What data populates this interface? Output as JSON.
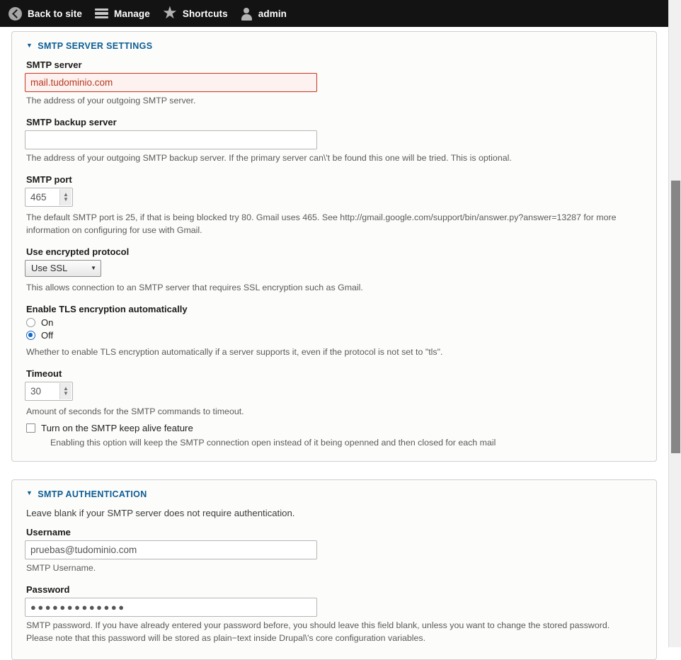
{
  "toolbar": {
    "items": [
      {
        "label": "Back to site",
        "icon": "back-circle-icon"
      },
      {
        "label": "Manage",
        "icon": "hamburger-icon"
      },
      {
        "label": "Shortcuts",
        "icon": "star-icon"
      },
      {
        "label": "admin",
        "icon": "user-icon"
      }
    ]
  },
  "server_panel": {
    "title": "SMTP SERVER SETTINGS",
    "caret": "▼",
    "smtp_server": {
      "label": "SMTP server",
      "value": "mail.tudominio.com",
      "description": "The address of your outgoing SMTP server.",
      "state": "error"
    },
    "smtp_backup": {
      "label": "SMTP backup server",
      "value": "",
      "description": "The address of your outgoing SMTP backup server. If the primary server can\\'t be found this one will be tried. This is optional."
    },
    "smtp_port": {
      "label": "SMTP port",
      "value": "465",
      "description": "The default SMTP port is 25, if that is being blocked try 80. Gmail uses 465. See http://gmail.google.com/support/bin/answer.py?answer=13287 for more information on configuring for use with Gmail."
    },
    "protocol": {
      "label": "Use encrypted protocol",
      "selected": "Use SSL",
      "arrow": "▼",
      "description": "This allows connection to an SMTP server that requires SSL encryption such as Gmail."
    },
    "tls": {
      "label": "Enable TLS encryption automatically",
      "options": [
        {
          "label": "On",
          "selected": false
        },
        {
          "label": "Off",
          "selected": true
        }
      ],
      "description": "Whether to enable TLS encryption automatically if a server supports it, even if the protocol is not set to \"tls\"."
    },
    "timeout": {
      "label": "Timeout",
      "value": "30",
      "description": "Amount of seconds for the SMTP commands to timeout."
    },
    "keepalive": {
      "label": "Turn on the SMTP keep alive feature",
      "checked": false,
      "description": "Enabling this option will keep the SMTP connection open instead of it being openned and then closed for each mail"
    }
  },
  "auth_panel": {
    "title": "SMTP AUTHENTICATION",
    "caret": "▼",
    "lead": "Leave blank if your SMTP server does not require authentication.",
    "username": {
      "label": "Username",
      "value": "pruebas@tudominio.com",
      "description": "SMTP Username."
    },
    "password": {
      "label": "Password",
      "value": "●●●●●●●●●●●●●",
      "description": "SMTP password. If you have already entered your password before, you should leave this field blank, unless you want to change the stored password. Please note that this password will be stored as plain−text inside Drupal\\'s core configuration variables."
    }
  },
  "scrollbar": {
    "name": "vertical-scrollbar"
  },
  "colors": {
    "toolbar_bg": "#131313",
    "panel_title": "#0c5d96",
    "error_border": "#c7371f",
    "error_bg": "#fdf2f0",
    "radio_accent": "#1469c4"
  }
}
